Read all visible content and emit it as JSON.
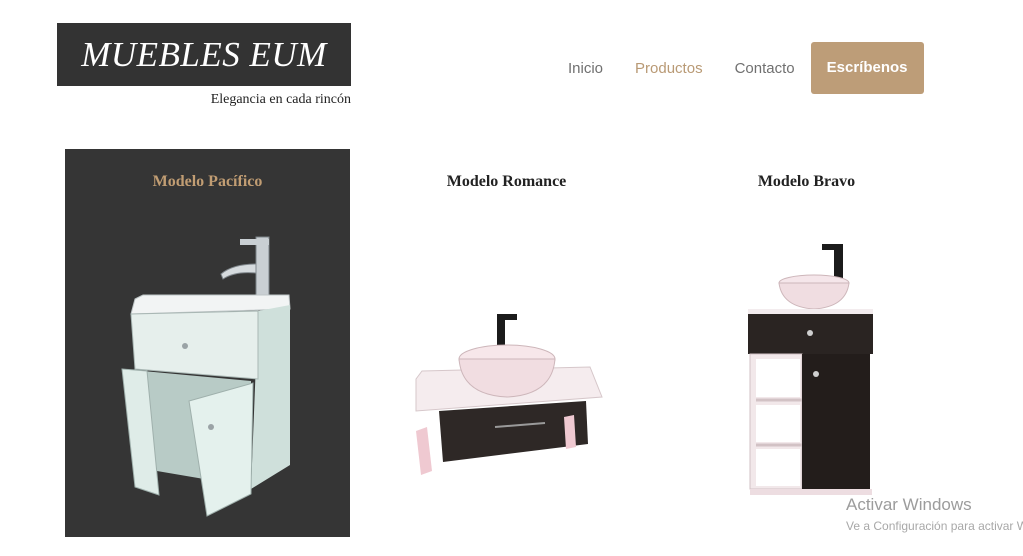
{
  "brand": {
    "name": "MUEBLES EUM",
    "tagline": "Elegancia en cada rincón"
  },
  "nav": {
    "items": [
      "Inicio",
      "Productos",
      "Contacto"
    ],
    "active": "Productos",
    "cta": "Escríbenos"
  },
  "products": [
    {
      "title": "Modelo Pacífico",
      "image": "bathroom-vanity-white-open-doors"
    },
    {
      "title": "Modelo Romance",
      "image": "floating-vanity-vessel-sink-pink"
    },
    {
      "title": "Modelo Bravo",
      "image": "standing-vanity-shelves-vessel-sink"
    }
  ],
  "watermark": {
    "title": "Activar Windows",
    "subtitle": "Ve a Configuración para activar Windows."
  },
  "colors": {
    "accent": "#bd9d78",
    "dark": "#333333"
  }
}
